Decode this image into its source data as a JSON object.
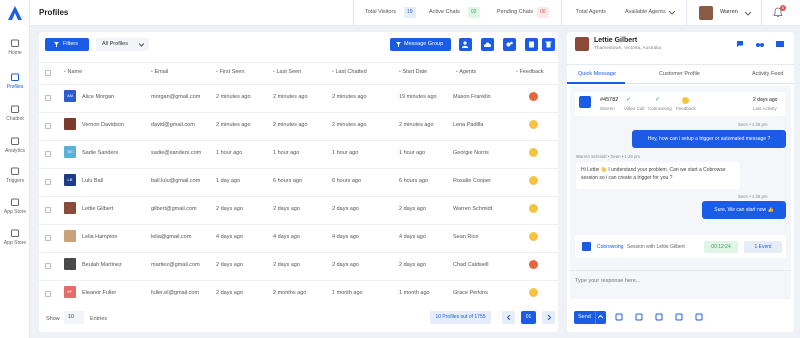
{
  "app": {
    "page_title": "Profiles",
    "user_name": "Warren",
    "notif_count": "6"
  },
  "nav": [
    {
      "label": "Home",
      "icon": "home-icon"
    },
    {
      "label": "Profiles",
      "icon": "users-icon"
    },
    {
      "label": "Chatbot",
      "icon": "bot-icon"
    },
    {
      "label": "Analytics",
      "icon": "chart-icon"
    },
    {
      "label": "Triggers",
      "icon": "trigger-icon"
    },
    {
      "label": "App Store",
      "icon": "grid-icon"
    },
    {
      "label": "App Store",
      "icon": "gear-icon"
    }
  ],
  "stats": {
    "visitors_label": "Total Visitors",
    "visitors_count": "19",
    "active_label": "Active Chats",
    "active_count": "02",
    "pending_label": "Pending Chats",
    "pending_count": "06",
    "agents_label": "Total Agents",
    "available_label": "Available Agents"
  },
  "toolbar": {
    "filters": "Filters",
    "profiles_select": "All Profiles",
    "message_group": "Message Group"
  },
  "table": {
    "headers": [
      "Name",
      "Email",
      "First Seen",
      "Last Seen",
      "Last Chatted",
      "Start Date",
      "Agents",
      "Feedback"
    ],
    "rows": [
      {
        "initials": "AM",
        "name": "Alice Morgan",
        "email": "morgan@gmail.com",
        "first": "2 minutes ago",
        "last": "2 minutes ago",
        "chatted": "2 minutes ago",
        "start": "19 minutes ago",
        "agent": "Mason Franklin",
        "av": "#2d5bd6",
        "emo": "#e8663d"
      },
      {
        "initials": "",
        "name": "Vernon Davidson",
        "email": "david@gmail.com",
        "first": "2 minutes ago",
        "last": "2 minutes ago",
        "chatted": "2 minutes ago",
        "start": "2 minutes ago",
        "agent": "Lena Padilla",
        "av": "#7a3b2e",
        "emo": "#f5c542"
      },
      {
        "initials": "SS",
        "name": "Sadie Sanders",
        "email": "sadie@sanders.com",
        "first": "1 hour ago",
        "last": "1 hour ago",
        "chatted": "1 hour ago",
        "start": "1 hour ago",
        "agent": "Georgie Norris",
        "av": "#5ab2d9",
        "emo": "#f5c542"
      },
      {
        "initials": "LB",
        "name": "Lulu Ball",
        "email": "ball.lulu@gmail.com",
        "first": "1 day ago",
        "last": "6 hours ago",
        "chatted": "6 hours ago",
        "start": "6 hours ago",
        "agent": "Rosalie Cooper",
        "av": "#1e3a8a",
        "emo": "#f5c542"
      },
      {
        "initials": "",
        "name": "Lettie Gilbert",
        "email": "gilbert@gmail.com",
        "first": "2 days ago",
        "last": "2 days ago",
        "chatted": "2 days ago",
        "start": "2 days ago",
        "agent": "Warren Schmidt",
        "av": "#8b4a3a",
        "emo": "#f5c542"
      },
      {
        "initials": "",
        "name": "Lelia Hampton",
        "email": "lelia@gmail.com",
        "first": "4 days ago",
        "last": "4 days ago",
        "chatted": "4 days ago",
        "start": "4 days ago",
        "agent": "Sean Rice",
        "av": "#c9a27a",
        "emo": "#f5c542"
      },
      {
        "initials": "",
        "name": "Beulah Martinez",
        "email": "martiez@gmail.com",
        "first": "2 days ago",
        "last": "2 days ago",
        "chatted": "2 days ago",
        "start": "2 days ago",
        "agent": "Chad Caldwell",
        "av": "#4a4a4a",
        "emo": "#e8663d"
      },
      {
        "initials": "EF",
        "name": "Eleanor Fuller",
        "email": "fuller.el@gmail.com",
        "first": "2 days ago",
        "last": "2 months ago",
        "chatted": "1 month ago",
        "start": "1 month ago",
        "agent": "Grace Perkins",
        "av": "#e86b6b",
        "emo": "#f5c542"
      }
    ]
  },
  "footer": {
    "show": "Show",
    "per_page": "10",
    "entries": "Entries",
    "count": "10 Profiles out of 1755",
    "page": "01"
  },
  "panel": {
    "name": "Lettie Gilbert",
    "location": "Thamestown, Victoria, Australia",
    "tabs": [
      "Quick Message",
      "Customer Profile",
      "Activity Feed"
    ],
    "ticket": "#45782",
    "ticket_sub": "Warren",
    "info": [
      {
        "label": "Video Call"
      },
      {
        "label": "Cobrowsing"
      },
      {
        "label": "Feedback"
      }
    ],
    "last_val": "2 days ago",
    "last_label": "Last Activity",
    "m1_meta": "Seen • 1:29 pm",
    "m1": "Hey, how can i setup a trigger or automated message ?",
    "m2_meta": "Warren Schmidt • Seen • 1:29 pm",
    "m2": "Hi Lettie 👋 I understand your problem. Can we start a Cobrowse session so i can create a trigger for you ?",
    "m3_meta": "Seen • 1:29 pm",
    "m3": "Sure, We can start now 👍",
    "cob_label": "Cobrowsing",
    "cob_text": "Session with Lettie Gilbert",
    "cob_time": "00:12:24",
    "cob_event": "1 Event",
    "reply_placeholder": "Type your response here...",
    "send": "Send"
  }
}
